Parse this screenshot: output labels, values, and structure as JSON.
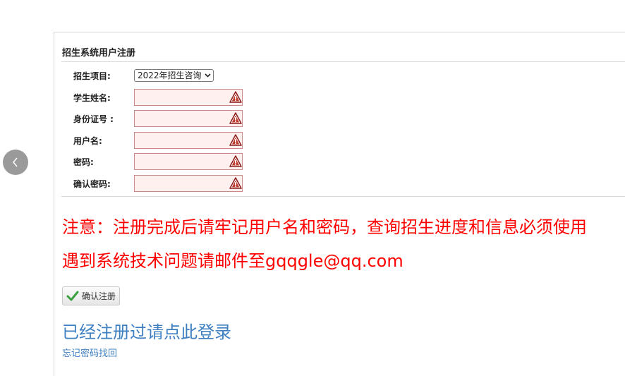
{
  "nav": {
    "prev_icon": "chevron-left-icon"
  },
  "panel": {
    "title": "招生系统用户注册"
  },
  "form": {
    "project": {
      "label": "招生项目:",
      "selected": "2022年招生咨询"
    },
    "student_name": {
      "label": "学生姓名:",
      "value": ""
    },
    "id_number": {
      "label": "身份证号 :",
      "value": ""
    },
    "username": {
      "label": "用户名:",
      "value": ""
    },
    "password": {
      "label": "密码:",
      "value": ""
    },
    "confirm_password": {
      "label": "确认密码:",
      "value": ""
    },
    "warning_icon": "warning-triangle-icon"
  },
  "notice": {
    "line1": "注意：注册完成后请牢记用户名和密码，查询招生进度和信息必须使用",
    "line2": "遇到系统技术问题请邮件至gqqgle@qq.com"
  },
  "actions": {
    "confirm_label": "确认注册",
    "confirm_icon": "checkmark-icon",
    "login_link": "已经注册过请点此登录",
    "forgot_link": "忘记密码找回"
  },
  "colors": {
    "notice": "#ff0000",
    "link": "#3d7fc1",
    "input_bg": "#fff0f0",
    "input_border": "#c98a8a"
  }
}
